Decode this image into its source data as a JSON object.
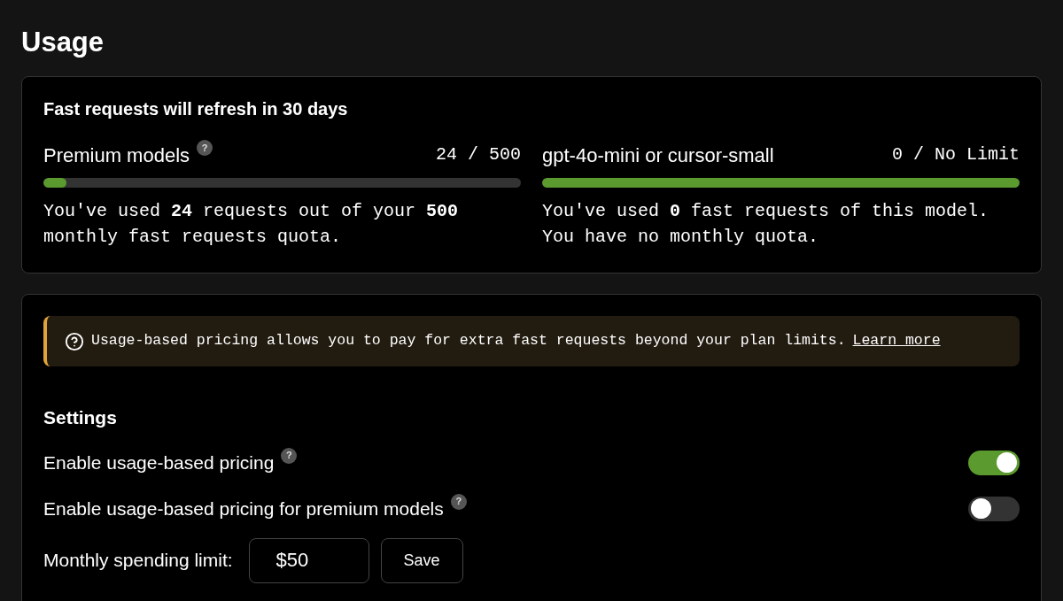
{
  "title": "Usage",
  "quota": {
    "heading": "Fast requests will refresh in 30 days",
    "meters": [
      {
        "label": "Premium models",
        "help": "?",
        "reading": "24 / 500",
        "level": 0.048,
        "description": "You've used **24** requests out of your **500** monthly fast requests quota."
      },
      {
        "label": "gpt-4o-mini or cursor-small",
        "reading": "0 / No Limit",
        "level": 1,
        "description": "You've used **0** fast requests of this model. You have no monthly quota."
      }
    ]
  },
  "notice": {
    "text": "Usage-based pricing allows you to pay for extra fast requests beyond your plan limits.",
    "link": "Learn more"
  },
  "settings": {
    "heading": "Settings",
    "toggles": [
      {
        "label": "Enable usage-based pricing",
        "help": "?",
        "on": true
      },
      {
        "label": "Enable usage-based pricing for premium models",
        "help": "?",
        "on": false
      }
    ],
    "limit": {
      "label": "Monthly spending limit:",
      "value": "$50",
      "button": "Save"
    }
  }
}
